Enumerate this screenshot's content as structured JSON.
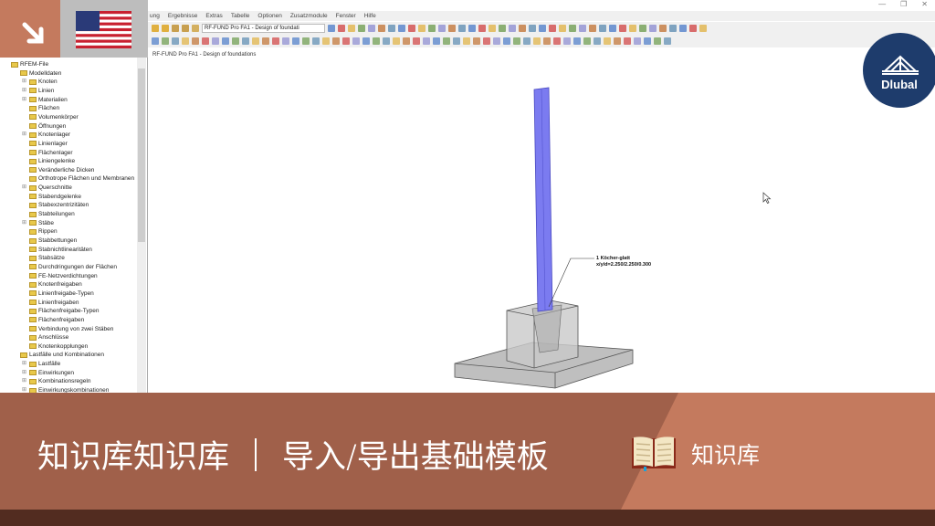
{
  "menu": [
    "ung",
    "Ergebnisse",
    "Extras",
    "Tabelle",
    "Optionen",
    "Zusatzmodule",
    "Fenster",
    "Hilfe"
  ],
  "toolbar": {
    "module_combo": "RF-FUND Pro FA1 - Design of foundati"
  },
  "canvas": {
    "title": "RF-FUND Pro FA1 - Design of foundations",
    "label_line1": "1 Köcher-glatt",
    "label_line2": "x/y/d=2.250/2.250/0.300"
  },
  "tree": {
    "root": "RFEM-File",
    "modelldaten": "Modelldaten",
    "items": [
      "Knoten",
      "Linien",
      "Materialien",
      "Flächen",
      "Volumenkörper",
      "Öffnungen",
      "Knotenlager",
      "Linienlager",
      "Flächenlager",
      "Liniengelenke",
      "Veränderliche Dicken",
      "Orthotrope Flächen und Membranen",
      "Querschnitte",
      "Stabendgelenke",
      "Stabexzentrizitäten",
      "Stabteilungen",
      "Stäbe",
      "Rippen",
      "Stabbettungen",
      "Stabnichtlinearitäten",
      "Stabsätze",
      "Durchdringungen der Flächen",
      "FE-Netzverdichtungen",
      "Knotenfreigaben",
      "Linienfreigabe-Typen",
      "Linienfreigaben",
      "Flächenfreigabe-Typen",
      "Flächenfreigaben",
      "Verbindung von zwei Stäben",
      "Anschlüsse",
      "Knotenkopplungen"
    ],
    "expandable": [
      0,
      1,
      2,
      6,
      12,
      16
    ],
    "lastfaelle": "Lastfälle und Kombinationen",
    "lf_items": [
      "Lastfälle",
      "Einwirkungen",
      "Kombinationsregeln",
      "Einwirkungskombinationen"
    ]
  },
  "logo": "Dlubal",
  "banner": {
    "part1": "知识库知识库",
    "part2": "导入/导出基础模板",
    "tag": "知识库"
  },
  "colors": {
    "orange": "#c47a5e",
    "band": "#a0604a",
    "dark": "#522c20",
    "logo": "#1e3c6c"
  }
}
